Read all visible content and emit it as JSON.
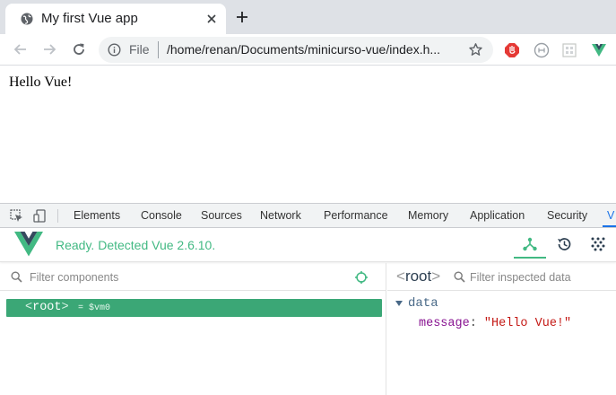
{
  "browser": {
    "tab": {
      "title": "My first Vue app",
      "favicon": "globe-icon"
    },
    "address": {
      "scheme_label": "File",
      "url": "/home/renan/Documents/minicurso-vue/index.h..."
    },
    "extensions": [
      "block-ads-icon",
      "extension-circle-icon",
      "extension-grid-icon",
      "vue-devtools-icon"
    ]
  },
  "page": {
    "text": "Hello Vue!"
  },
  "devtools": {
    "tabs": [
      "Elements",
      "Console",
      "Sources",
      "Network",
      "Performance",
      "Memory",
      "Application",
      "Security",
      "V"
    ],
    "active_tab_index": 8,
    "vue": {
      "status": "Ready. Detected Vue 2.6.10.",
      "brand_color": "#42b983",
      "components": {
        "filter_placeholder": "Filter components",
        "selected": {
          "tag_open": "<",
          "name": "root",
          "tag_close": ">",
          "vm_label": "= $vm0"
        }
      },
      "inspector": {
        "component": {
          "tag_open": "<",
          "name": "root",
          "tag_close": ">"
        },
        "filter_placeholder": "Filter inspected data",
        "section": "data",
        "props": [
          {
            "key": "message",
            "value": "\"Hello Vue!\""
          }
        ]
      }
    }
  }
}
